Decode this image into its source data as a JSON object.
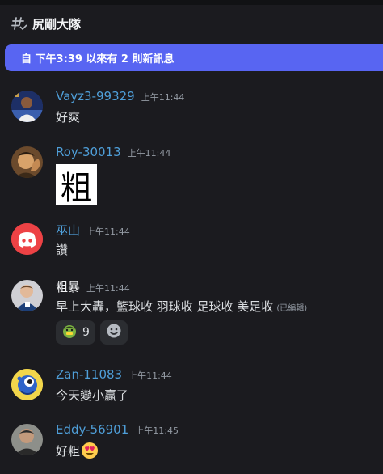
{
  "channel": {
    "name": "尻剛大隊",
    "icon": "threads-icon"
  },
  "banner": {
    "text": "自 下午3:39 以來有 2 則新訊息"
  },
  "messages": [
    {
      "author": "Vayz3-99329",
      "time": "上午11:44",
      "text": "好爽"
    },
    {
      "author": "Roy-30013",
      "time": "上午11:44",
      "image_text": "粗"
    },
    {
      "author": "巫山",
      "time": "上午11:44",
      "text": "讚"
    },
    {
      "author": "粗暴",
      "time": "上午11:44",
      "text": "早上大轟，籃球收 羽球收 足球收 美足收",
      "edited": "(已編輯)",
      "reactions": [
        {
          "emoji": "hulk-emoji",
          "count": "9"
        },
        {
          "emoji": "add-reaction-icon",
          "count": ""
        }
      ]
    },
    {
      "author": "Zan-11083",
      "time": "上午11:44",
      "text": "今天變小贏了"
    },
    {
      "author": "Eddy-56901",
      "time": "上午11:45",
      "text": "好粗",
      "emoji": "heart-eyes-emoji"
    }
  ],
  "colors": {
    "background": "#1b1b1f",
    "accent": "#5865f2",
    "author_blue": "#4f9fd9",
    "timestamp": "#949ba4"
  }
}
